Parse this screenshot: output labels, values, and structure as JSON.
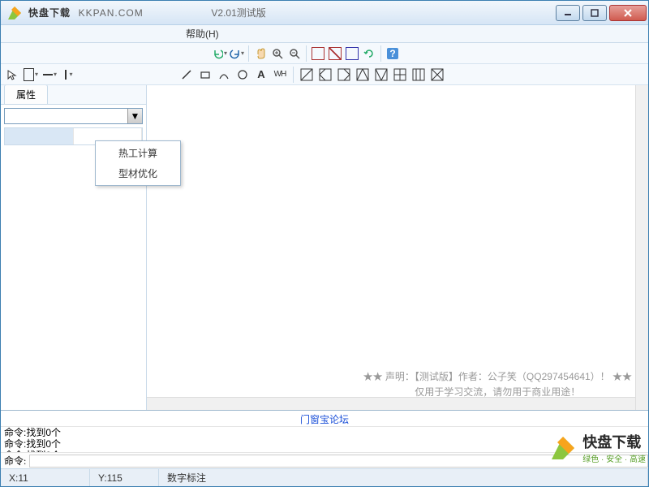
{
  "titlebar": {
    "brand": "快盘下载",
    "brand_url": "KKPAN.COM",
    "version": "V2.01测试版"
  },
  "menubar": {
    "help": "帮助(H)"
  },
  "popup": {
    "item1": "热工计算",
    "item2": "型材优化"
  },
  "sidebar": {
    "tab_props": "属性"
  },
  "canvas": {
    "notice_line1": "★★ 声明：【测试版】作者：公子笑（QQ297454641）！ ★★",
    "notice_line2": "仅用于学习交流，请勿用于商业用途！"
  },
  "cmd": {
    "link": "门窗宝论坛",
    "label": "命令:",
    "log_prefix": "命令:",
    "log_text": "找到0个"
  },
  "statusbar": {
    "x_label": "X:",
    "x_val": "11",
    "y_label": "Y:",
    "y_val": "115",
    "mode": "数字标注"
  },
  "watermark": {
    "zh": "快盘下载",
    "sub": "绿色 · 安全 · 高速"
  }
}
